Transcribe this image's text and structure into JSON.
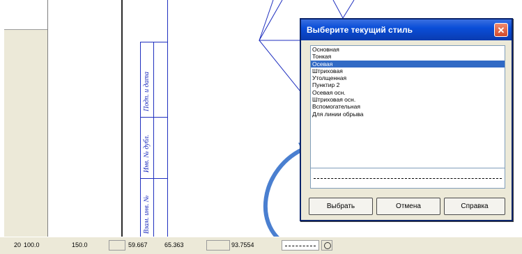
{
  "dialog": {
    "title": "Выберите текущий стиль",
    "close_glyph": "✕",
    "styles": [
      "Основная",
      "Тонкая",
      "Осевая",
      "Штриховая",
      "Утолщенная",
      "Пунктир 2",
      "Осевая осн.",
      "Штриховая осн.",
      "Вспомогательная",
      "Для линии обрыва"
    ],
    "selected_index": 2,
    "buttons": {
      "select": "Выбрать",
      "cancel": "Отмена",
      "help": "Справка"
    }
  },
  "drawing": {
    "stamp_texts": [
      "Подп. и дата",
      "Инв. № дубл.",
      "Взам. инв. №"
    ]
  },
  "statusbar": {
    "items": [
      {
        "label": "20",
        "value": "100.0"
      },
      {
        "label": "",
        "value": "150.0"
      },
      {
        "label": "",
        "value": "59.667"
      },
      {
        "label": "",
        "value": "65.363"
      },
      {
        "label": "",
        "value": "93.7554"
      }
    ]
  },
  "colors": {
    "titlebar": "#0a4ed8",
    "selection": "#316ac5",
    "drawing_lines": "#1f2fbf",
    "arrow": "#4a7fd0"
  }
}
